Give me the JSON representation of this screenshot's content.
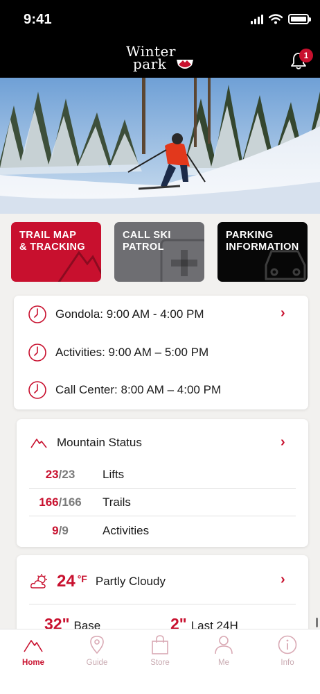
{
  "status_bar": {
    "time": "9:41"
  },
  "header": {
    "logo_line1": "Winter",
    "logo_line2": "park",
    "notification_count": "1"
  },
  "tiles": [
    {
      "label": "TRAIL MAP\n& TRACKING",
      "color": "#c8102e"
    },
    {
      "label": "CALL SKI\nPATROL",
      "color": "#6e6e72"
    },
    {
      "label": "PARKING\nINFORMATION",
      "color": "#070707"
    }
  ],
  "hours": [
    {
      "name": "Gondola",
      "sep": ":",
      "time": "9:00 AM - 4:00 PM",
      "has_link": true
    },
    {
      "name": "Activities",
      "sep": ":",
      "time": "9:00 AM – 5:00 PM",
      "has_link": false
    },
    {
      "name": "Call Center",
      "sep": ":",
      "time": "8:00 AM – 4:00 PM",
      "has_link": false
    }
  ],
  "mountain_status": {
    "title": "Mountain Status",
    "rows": [
      {
        "open": "23",
        "total": "/23",
        "label": "Lifts"
      },
      {
        "open": "166",
        "total": "/166",
        "label": "Trails"
      },
      {
        "open": "9",
        "total": "/9",
        "label": "Activities"
      }
    ]
  },
  "weather": {
    "temp": "24",
    "unit": "°F",
    "condition": "Partly Cloudy",
    "base_value": "32\"",
    "base_label": "Base",
    "new_value": "2\"",
    "new_label": "Last 24H"
  },
  "tabbar": {
    "tabs": [
      {
        "label": "Home",
        "icon": "mountain-icon",
        "active": true
      },
      {
        "label": "Guide",
        "icon": "map-pin-icon",
        "active": false
      },
      {
        "label": "Store",
        "icon": "shopping-bag-icon",
        "active": false
      },
      {
        "label": "Me",
        "icon": "person-icon",
        "active": false
      },
      {
        "label": "Info",
        "icon": "info-icon",
        "active": false
      }
    ]
  },
  "colors": {
    "accent": "#c8102e",
    "inactive_tab": "#c9aab1"
  }
}
